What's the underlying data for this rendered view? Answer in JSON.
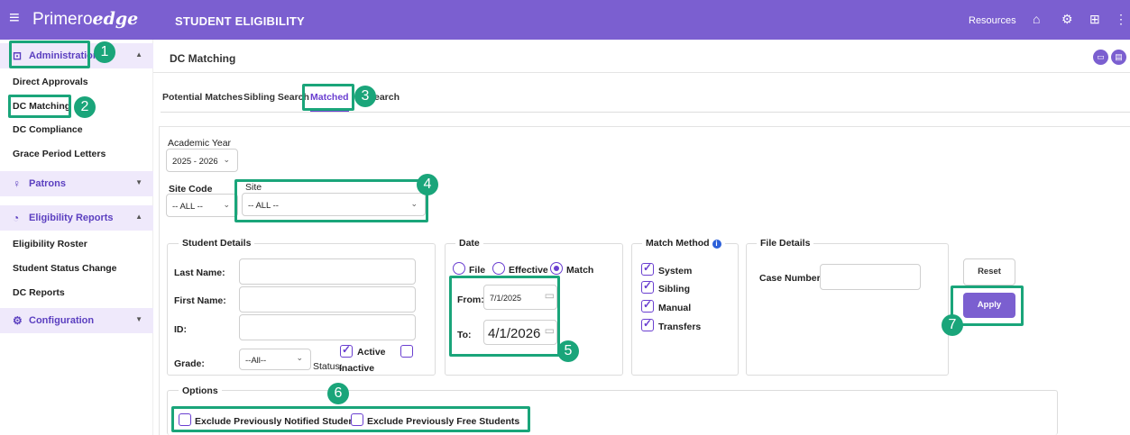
{
  "topbar": {
    "logo_primary": "Primero",
    "logo_edge": "edge",
    "app_title": "STUDENT ELIGIBILITY",
    "resources_label": "Resources"
  },
  "sidebar": {
    "sections": [
      {
        "label": "Administration",
        "icon": "badge-icon"
      },
      {
        "label": "Patrons",
        "icon": "person-icon"
      },
      {
        "label": "Eligibility Reports",
        "icon": "report-icon"
      },
      {
        "label": "Configuration",
        "icon": "gear-icon"
      }
    ],
    "admin_items": [
      "Direct Approvals",
      "DC Matching",
      "DC Compliance",
      "Grace Period Letters"
    ],
    "report_items": [
      "Eligibility Roster",
      "Student Status Change",
      "DC Reports"
    ]
  },
  "page": {
    "title": "DC Matching",
    "tabs": [
      "Potential Matches",
      "Sibling Search",
      "Matched",
      "Search"
    ]
  },
  "filters": {
    "academic_year_label": "Academic Year",
    "academic_year_value": "2025 - 2026",
    "site_code_label": "Site Code",
    "site_code_value": "-- ALL --",
    "site_label": "Site",
    "site_value": "-- ALL --"
  },
  "student_details": {
    "title": "Student Details",
    "last_name_label": "Last Name:",
    "first_name_label": "First Name:",
    "id_label": "ID:",
    "grade_label": "Grade:",
    "grade_value": "--All--",
    "status_label": "Status:",
    "active_label": "Active",
    "inactive_label": "Inactive"
  },
  "date": {
    "title": "Date",
    "opt_file": "File",
    "opt_effective": "Effective",
    "opt_match": "Match",
    "from_label": "From:",
    "from_value": "7/1/2025",
    "to_label": "To:",
    "to_value": "4/1/2026"
  },
  "match_method": {
    "title": "Match Method",
    "options": [
      "System",
      "Sibling",
      "Manual",
      "Transfers"
    ]
  },
  "file_details": {
    "title": "File Details",
    "case_number_label": "Case Number:"
  },
  "actions": {
    "reset_label": "Reset",
    "apply_label": "Apply"
  },
  "options": {
    "title": "Options",
    "exclude_notified": "Exclude Previously Notified Students",
    "exclude_free": "Exclude Previously Free Students"
  },
  "callouts": [
    "1",
    "2",
    "3",
    "4",
    "5",
    "6",
    "7"
  ],
  "colors": {
    "brand": "#7b5fd0",
    "accent": "#6a3fd0",
    "highlight": "#1aa57a"
  }
}
